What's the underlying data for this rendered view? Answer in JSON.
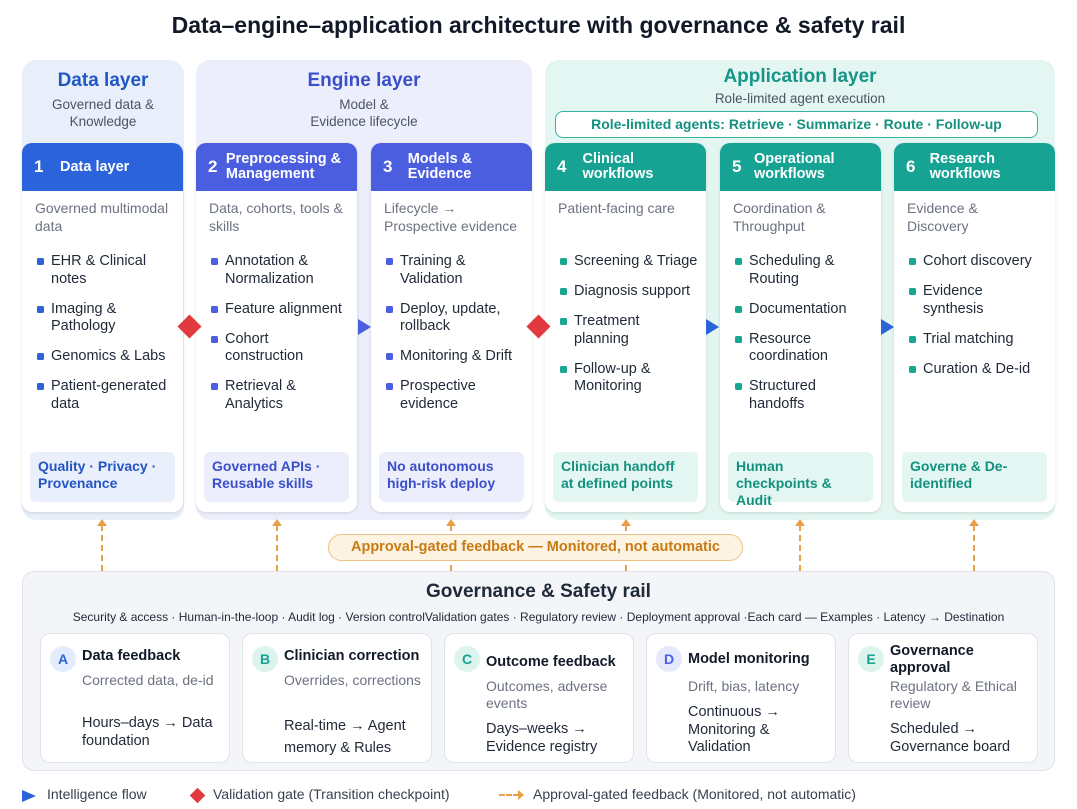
{
  "title": "Data–engine–application architecture with governance & safety rail",
  "layers": {
    "data": {
      "title": "Data layer",
      "subtitle": "Governed data & Knowledge"
    },
    "engine": {
      "title": "Engine layer",
      "subtitle_1": "Model &",
      "subtitle_2": "Evidence lifecycle"
    },
    "app": {
      "title": "Application layer",
      "subtitle": "Role-limited agent execution",
      "agents": "Role-limited agents: Retrieve · Summarize · Route · Follow-up"
    }
  },
  "cards": [
    {
      "num": "1",
      "title": "Data layer",
      "subtitle": "Governed multimodal data",
      "items": [
        "EHR & Clinical notes",
        "Imaging & Pathology",
        "Genomics & Labs",
        "Patient-generated data"
      ],
      "footer": "Quality · Privacy · Provenance",
      "color": "#2b63db"
    },
    {
      "num": "2",
      "title": "Preprocessing & Management",
      "subtitle": "Data, cohorts, tools & skills",
      "items": [
        "Annotation & Normalization",
        "Feature alignment",
        "Cohort construction",
        "Retrieval & Analytics"
      ],
      "footer": "Governed APIs · Reusable skills",
      "color": "#4b5ee0"
    },
    {
      "num": "3",
      "title": "Models & Evidence",
      "subtitle": "Lifecycle → Prospective evidence",
      "items": [
        "Training & Validation",
        "Deploy, update, rollback",
        "Monitoring & Drift",
        "Prospective evidence"
      ],
      "footer": "No autonomous high-risk deploy",
      "color": "#4b5ee0"
    },
    {
      "num": "4",
      "title": "Clinical workflows",
      "subtitle": "Patient-facing care",
      "items": [
        "Screening & Triage",
        "Diagnosis support",
        "Treatment planning",
        "Follow-up & Monitoring"
      ],
      "footer": "Clinician handoff at defined points",
      "color": "#16a393"
    },
    {
      "num": "5",
      "title": "Operational workflows",
      "subtitle": "Coordination & Throughput",
      "items": [
        "Scheduling & Routing",
        "Documentation",
        "Resource coordination",
        "Structured handoffs"
      ],
      "footer": "Human checkpoints & Audit",
      "color": "#16a393"
    },
    {
      "num": "6",
      "title": "Research workflows",
      "subtitle": "Evidence & Discovery",
      "items": [
        "Cohort discovery",
        "Evidence synthesis",
        "Trial matching",
        "Curation & De-id"
      ],
      "footer": "Governe & De-identified",
      "color": "#16a393"
    }
  ],
  "approval_feedback": "Approval-gated feedback — Monitored, not automatic",
  "rail": {
    "title": "Governance & Safety rail",
    "items": "Security & access · Human-in-the-loop · Audit log · Version controlValidation gates · Regulatory review · Deployment approval ·Each card — Examples · Latency → Destination",
    "cards": [
      {
        "letter": "A",
        "title": "Data feedback",
        "subtitle": "Corrected data, de-id",
        "cadence": "Hours–days → Data foundation"
      },
      {
        "letter": "B",
        "title": "Clinician correction",
        "subtitle": "Overrides, corrections",
        "cadence": "Real-time → Agent memory & Rules"
      },
      {
        "letter": "C",
        "title": "Outcome feedback",
        "subtitle": "Outcomes, adverse events",
        "cadence": "Days–weeks → Evidence registry"
      },
      {
        "letter": "D",
        "title": "Model monitoring",
        "subtitle": "Drift, bias, latency",
        "cadence": "Continuous → Monitoring & Validation"
      },
      {
        "letter": "E",
        "title": "Governance approval",
        "subtitle": "Regulatory & Ethical review",
        "cadence": "Scheduled → Governance board"
      }
    ]
  },
  "legend": {
    "flow": "Intelligence flow",
    "gate": "Validation gate (Transition checkpoint)",
    "feedback": "Approval-gated feedback (Monitored, not automatic)"
  },
  "colors": {
    "data_blue": "#2b63db",
    "engine_indigo": "#4b5ee0",
    "app_teal": "#16a393",
    "gate_red": "#e03a3e",
    "feedback_orange": "#e6a04a"
  }
}
